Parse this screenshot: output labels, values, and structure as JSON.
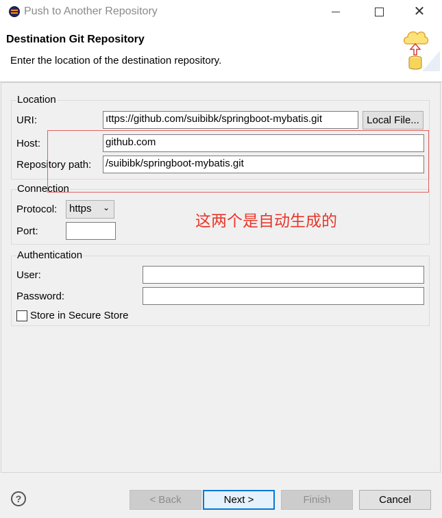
{
  "window": {
    "title": "Push to Another Repository",
    "close_glyph": "✕"
  },
  "header": {
    "title": "Destination Git Repository",
    "description": "Enter the location of the destination repository.",
    "icon": "cloud-upload-database-icon"
  },
  "location": {
    "group_label": "Location",
    "uri_label": "URI:",
    "uri_value": "ıttps://github.com/suibibk/springboot-mybatis.git",
    "local_file_button": "Local File...",
    "host_label": "Host:",
    "host_value": "github.com",
    "repo_path_label": "Repository path:",
    "repo_path_value": "/suibibk/springboot-mybatis.git"
  },
  "annotation": {
    "text": "这两个是自动生成的",
    "color": "#e8372b"
  },
  "connection": {
    "group_label": "Connection",
    "protocol_label": "Protocol:",
    "protocol_value": "https",
    "port_label": "Port:",
    "port_value": ""
  },
  "authentication": {
    "group_label": "Authentication",
    "user_label": "User:",
    "user_value": "",
    "password_label": "Password:",
    "password_value": "",
    "store_label": "Store in Secure Store"
  },
  "footer": {
    "help_glyph": "?",
    "back_button": "< Back",
    "next_button": "Next >",
    "finish_button": "Finish",
    "cancel_button": "Cancel"
  }
}
